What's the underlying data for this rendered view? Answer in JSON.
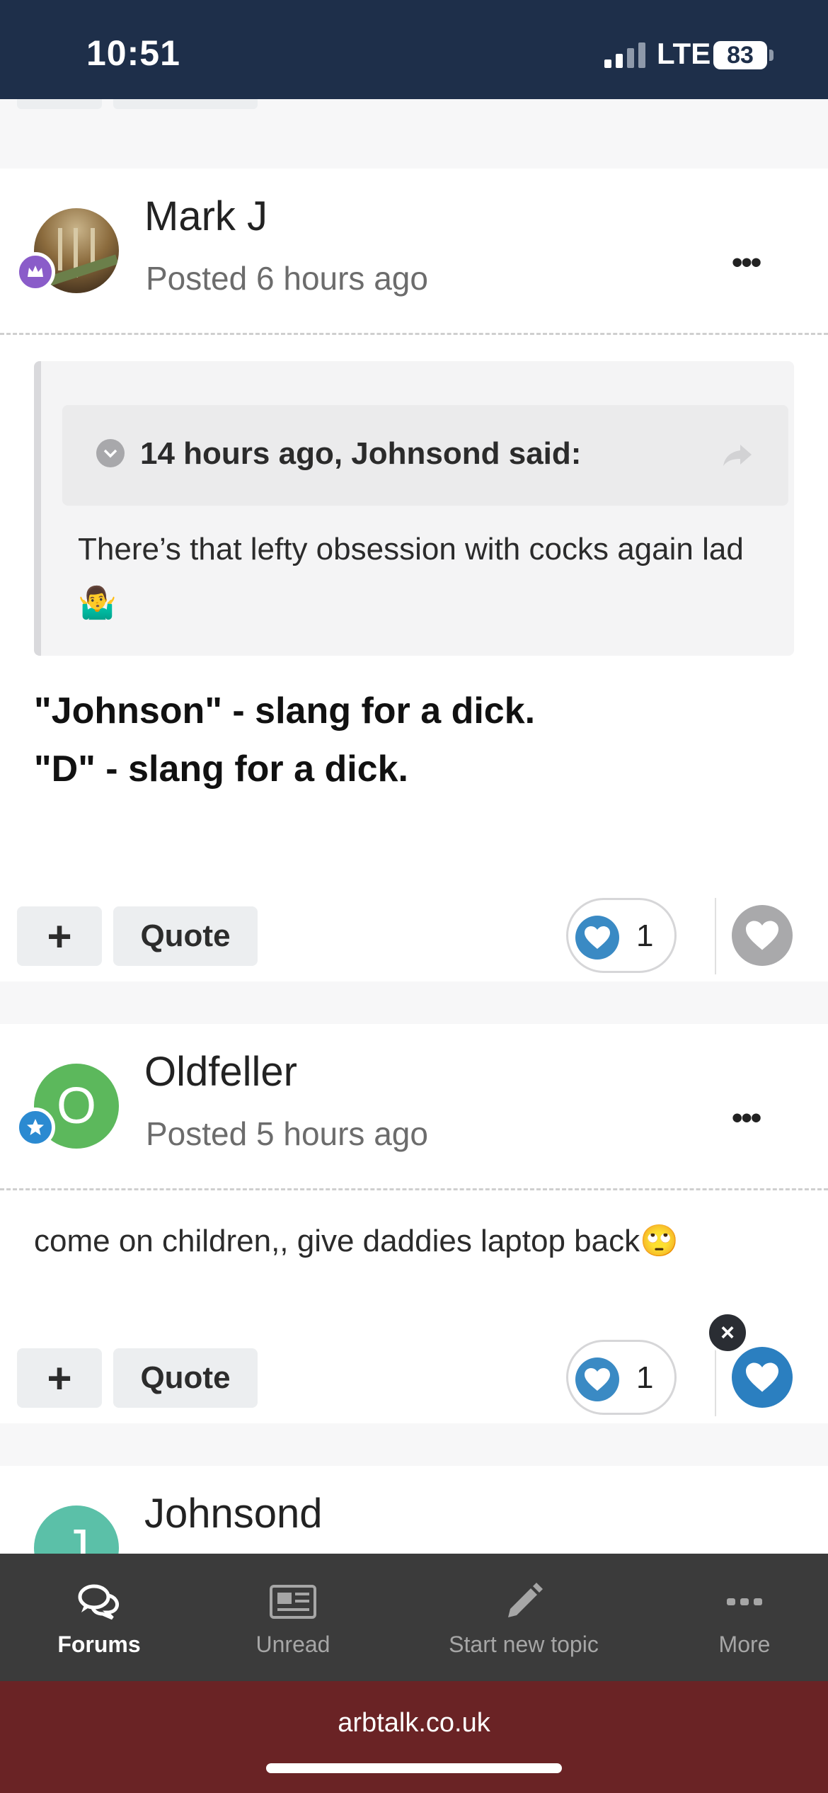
{
  "status_bar": {
    "time": "10:51",
    "network": "LTE",
    "battery": "83"
  },
  "posts": [
    {
      "author": "Mark J",
      "posted": "Posted 6 hours ago",
      "quote": {
        "cite": "14 hours ago, Johnsond said:",
        "text": "There’s that lefty obsession with cocks again lad 🤷‍♂️"
      },
      "body_lines": [
        "\"Johnson\" - slang for a dick.",
        "\"D\" - slang for a dick."
      ],
      "reaction_count": "1",
      "user_reacted": false
    },
    {
      "author": "Oldfeller",
      "avatar_letter": "O",
      "posted": "Posted 5 hours ago",
      "body": "come on children,, give daddies laptop back🙄",
      "reaction_count": "1",
      "user_reacted": true
    },
    {
      "author": "Johnsond",
      "avatar_letter": "J"
    }
  ],
  "actions": {
    "plus": "+",
    "quote": "Quote",
    "more": "•••",
    "close": "×"
  },
  "tabbar": {
    "forums": "Forums",
    "unread": "Unread",
    "new_topic": "Start new topic",
    "more": "More"
  },
  "browser": {
    "url": "arbtalk.co.uk"
  },
  "colors": {
    "status_bar": "#1e2f4a",
    "accent_blue": "#3a8ac4",
    "url_bar": "#6a2325",
    "tabbar": "#3b3b3b"
  }
}
